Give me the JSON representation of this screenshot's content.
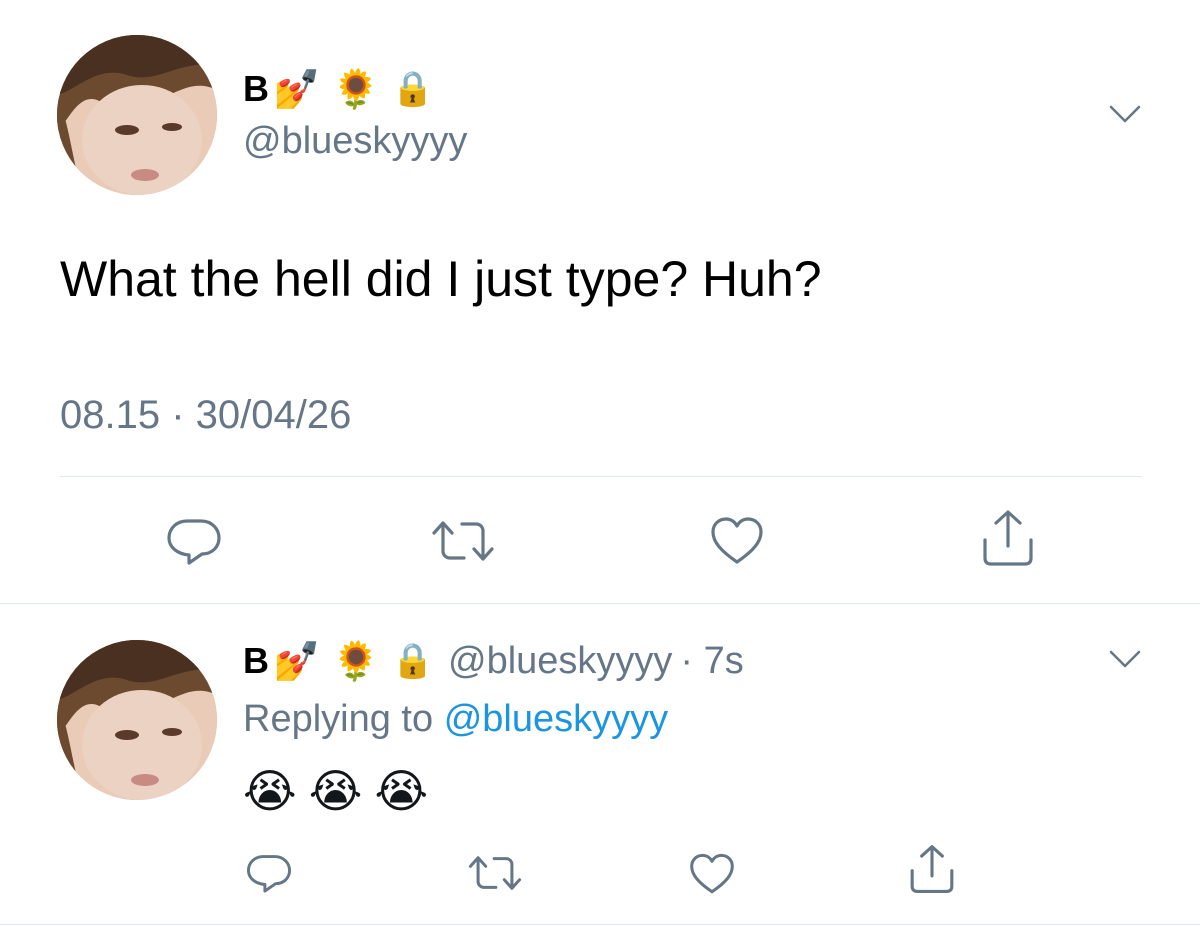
{
  "main_tweet": {
    "display_name": "B",
    "emojis": [
      "💅",
      "🌻",
      "🔒"
    ],
    "handle": "@blueskyyyy",
    "text": "What the hell did I just type? Huh?",
    "timestamp": "08.15 · 30/04/26",
    "avatar": "avatar-photo",
    "actions": [
      "reply-icon",
      "retweet-icon",
      "like-icon",
      "share-icon"
    ]
  },
  "reply_tweet": {
    "display_name": "B",
    "emojis": [
      "💅",
      "🌻",
      "🔒"
    ],
    "handle": "@blueskyyyy",
    "time_ago": "· 7s",
    "replying_label": "Replying to",
    "replying_handle": "@blueskyyyy",
    "text": "😭😭😭",
    "avatar": "avatar-photo",
    "actions": [
      "reply-icon",
      "retweet-icon",
      "like-icon",
      "share-icon"
    ]
  },
  "colors": {
    "handle": "#657786",
    "link": "#1b95e0",
    "divider": "#e1e8ed",
    "text": "#000000"
  }
}
